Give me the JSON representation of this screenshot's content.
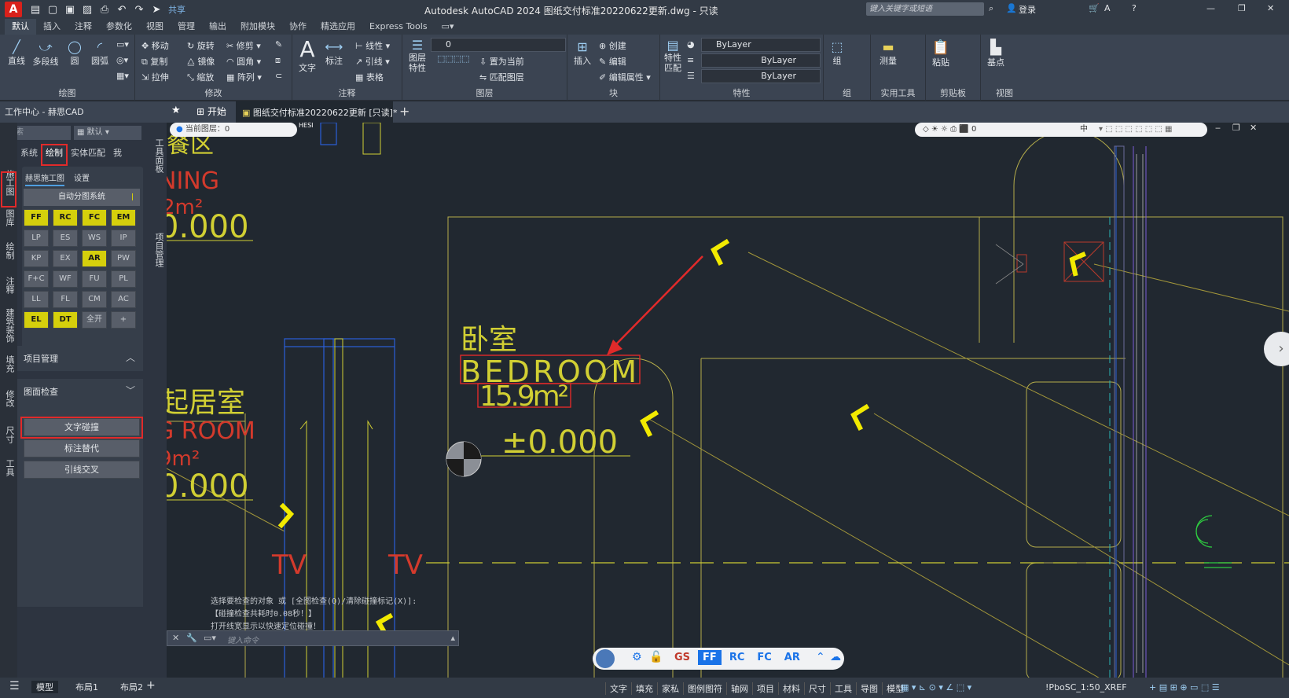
{
  "app": {
    "logo": "A",
    "title": "Autodesk AutoCAD 2024    图纸交付标准20220622更新.dwg - 只读",
    "share": "共享",
    "search_placeholder": "键入关键字或短语",
    "login": "登录"
  },
  "menu_tabs": [
    "默认",
    "插入",
    "注释",
    "参数化",
    "视图",
    "管理",
    "输出",
    "附加模块",
    "协作",
    "精选应用",
    "Express Tools"
  ],
  "ribbon": {
    "draw": {
      "title": "绘图",
      "items": [
        "直线",
        "多段线",
        "圆",
        "圆弧"
      ]
    },
    "modify": {
      "title": "修改",
      "items": [
        "移动",
        "旋转",
        "修剪",
        "复制",
        "镜像",
        "圆角",
        "拉伸",
        "缩放",
        "阵列"
      ]
    },
    "annotation": {
      "title": "注释",
      "items": [
        "文字",
        "标注",
        "线性",
        "引线",
        "表格"
      ]
    },
    "layers": {
      "title": "图层",
      "items": [
        "图层特性",
        "置为当前",
        "匹配图层"
      ],
      "current_layer": "0"
    },
    "block": {
      "title": "块",
      "items": [
        "插入",
        "创建",
        "编辑",
        "编辑属性"
      ]
    },
    "properties": {
      "title": "特性",
      "items": [
        "特性匹配"
      ],
      "color": "ByLayer",
      "linetype": "ByLayer",
      "lineweight": "ByLayer"
    },
    "groups": {
      "title": "组",
      "items": [
        "组"
      ]
    },
    "utilities": {
      "title": "实用工具",
      "items": [
        "测量"
      ]
    },
    "clipboard": {
      "title": "剪贴板",
      "items": [
        "粘贴"
      ]
    },
    "view": {
      "title": "视图",
      "items": [
        "基点"
      ]
    }
  },
  "doc_tabs": {
    "workcenter": "工作中心 - 赫思CAD",
    "start": "开始",
    "file": "图纸交付标准20220622更新 [只读]*"
  },
  "left_panel": {
    "search_placeholder": "搜索",
    "default_label": "默认",
    "top_tabs": [
      "系统",
      "绘制",
      "实体匹配",
      "我"
    ],
    "vertical_tabs": [
      "施工图",
      "图库",
      "绘制",
      "注释",
      "建筑装饰",
      "填充",
      "修改",
      "尺寸",
      "工具"
    ],
    "sub_tabs": [
      "赫思施工图",
      "设置"
    ],
    "auto_system": "自动分图系统",
    "grid": [
      {
        "label": "FF",
        "hl": true
      },
      {
        "label": "RC",
        "hl": true
      },
      {
        "label": "FC",
        "hl": true
      },
      {
        "label": "EM",
        "hl": true
      },
      {
        "label": "LP",
        "hl": false
      },
      {
        "label": "ES",
        "hl": false
      },
      {
        "label": "WS",
        "hl": false
      },
      {
        "label": "IP",
        "hl": false
      },
      {
        "label": "KP",
        "hl": false
      },
      {
        "label": "EX",
        "hl": false
      },
      {
        "label": "AR",
        "hl": true
      },
      {
        "label": "PW",
        "hl": false
      },
      {
        "label": "F+C",
        "hl": false
      },
      {
        "label": "WF",
        "hl": false
      },
      {
        "label": "FU",
        "hl": false
      },
      {
        "label": "PL",
        "hl": false
      },
      {
        "label": "LL",
        "hl": false
      },
      {
        "label": "FL",
        "hl": false
      },
      {
        "label": "CM",
        "hl": false
      },
      {
        "label": "AC",
        "hl": false
      },
      {
        "label": "EL",
        "hl": true
      },
      {
        "label": "DT",
        "hl": true
      },
      {
        "label": "全开",
        "hl": false
      },
      {
        "label": "+",
        "hl": false
      }
    ],
    "project_mgmt": "项目管理",
    "drawing_check": "图面检查",
    "check_buttons": [
      "文字碰撞",
      "标注替代",
      "引线交叉"
    ],
    "side_labels": [
      "工具面板",
      "项目管理"
    ]
  },
  "canvas": {
    "layer_bar": "当前图层：0",
    "right_layer": "0",
    "right_center": "中",
    "texts": {
      "dining_cn": "餐区",
      "dining_en": "NING",
      "dining_area": "2m²",
      "dining_level": "0.000",
      "bedroom_cn": "卧室",
      "bedroom_en": "BEDROOM",
      "bedroom_area": "15.9m²",
      "bedroom_level": "±0.000",
      "living_cn": "起居室",
      "living_en": "G ROOM",
      "living_area": "9m²",
      "living_level": "0.000",
      "tv1": "TV",
      "tv2": "TV",
      "hesi": "HESI"
    },
    "cmd_lines": [
      "选择要检查的对象 或 [全图检查(Q)/清除碰撞标记(X)]:",
      "【碰撞检查共耗时0.08秒！】",
      "打开线宽显示以快速定位碰撞！"
    ],
    "cmd_placeholder": "键入命令",
    "bottom_bar": [
      "GS",
      "FF",
      "RC",
      "FC",
      "AR"
    ]
  },
  "statusbar": {
    "tabs": [
      "模型",
      "布局1",
      "布局2"
    ],
    "right_items": [
      "文字",
      "填充",
      "家私",
      "图例图符",
      "轴网",
      "项目",
      "材料",
      "尺寸",
      "工具",
      "导图",
      "模型"
    ],
    "scale": "!PboSC_1:50_XREF"
  },
  "colors": {
    "accent": "#d5cf0c",
    "highlight_red": "#e12a2a",
    "canvas_bg": "#212830"
  }
}
